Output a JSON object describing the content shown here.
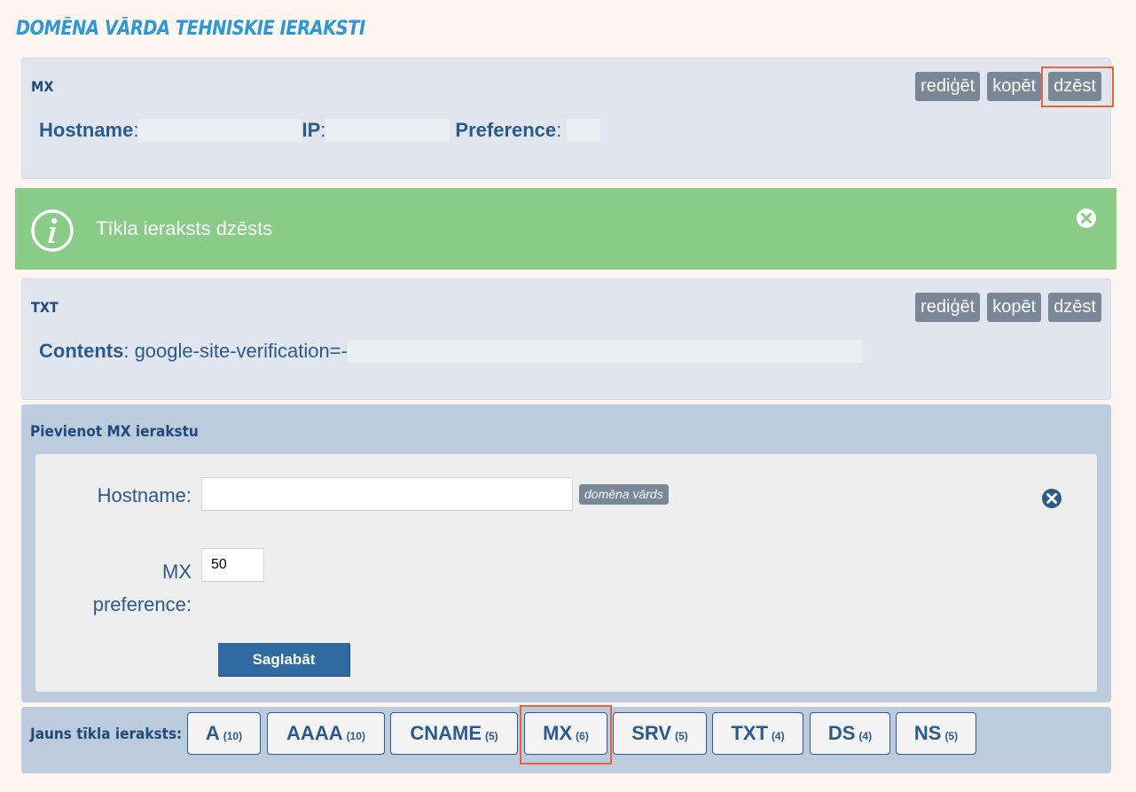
{
  "page_title": "DOMĒNA VĀRDA TEHNISKIE IERAKSTI",
  "records": [
    {
      "type": "MX",
      "actions": [
        "rediģēt",
        "kopēt",
        "dzēst"
      ],
      "fields": [
        {
          "label": "Hostname",
          "sep": ":"
        },
        {
          "label": "IP",
          "sep": ":"
        },
        {
          "label": "Preference",
          "sep": ":"
        }
      ]
    },
    {
      "type": "TXT",
      "actions": [
        "rediģēt",
        "kopēt",
        "dzēst"
      ],
      "fields": [
        {
          "label": "Contents",
          "sep": ":",
          "value": " google-site-verification=-"
        }
      ]
    }
  ],
  "alert": {
    "message": "Tīkla ieraksts dzēsts",
    "icon": "info-icon",
    "close_icon": "close-circle-icon"
  },
  "add_form": {
    "title": "Pievienot MX ierakstu",
    "hostname_label": "Hostname:",
    "hostname_value": "",
    "domain_tag": "domēna vārds",
    "mx_label_line1": "MX",
    "mx_label_line2": "preference:",
    "mx_value": "50",
    "save_label": "Saglabāt",
    "close_icon": "close-circle-icon"
  },
  "new_record": {
    "label": "Jauns tīkla ieraksts:",
    "types": [
      {
        "name": "A",
        "count": "(10)"
      },
      {
        "name": "AAAA",
        "count": "(10)"
      },
      {
        "name": "CNAME",
        "count": "(5)"
      },
      {
        "name": "MX",
        "count": "(6)"
      },
      {
        "name": "SRV",
        "count": "(5)"
      },
      {
        "name": "TXT",
        "count": "(4)"
      },
      {
        "name": "DS",
        "count": "(4)"
      },
      {
        "name": "NS",
        "count": "(5)"
      }
    ]
  },
  "colors": {
    "accent": "#2e98d2",
    "success": "#88cc88",
    "highlight": "#e8643a",
    "button": "#2f6aa3"
  }
}
